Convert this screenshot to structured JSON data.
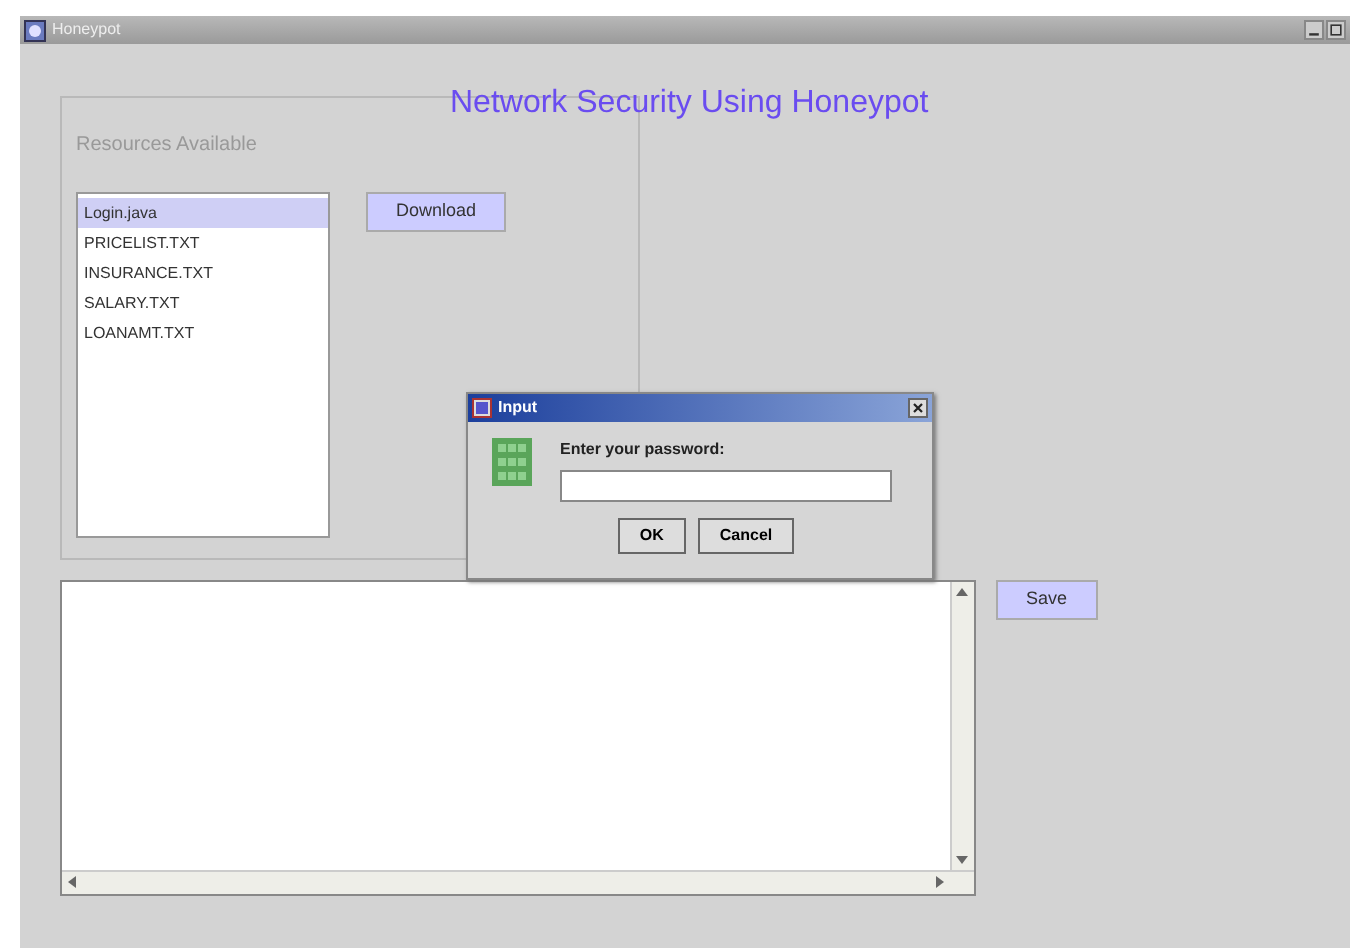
{
  "window": {
    "title": "Honeypot"
  },
  "heading": "Network Security Using Honeypot",
  "resources": {
    "label": "Resources Available",
    "download_button": "Download",
    "files": [
      {
        "name": "Login.java",
        "selected": true
      },
      {
        "name": "PRICELIST.TXT",
        "selected": false
      },
      {
        "name": "INSURANCE.TXT",
        "selected": false
      },
      {
        "name": "SALARY.TXT",
        "selected": false
      },
      {
        "name": "LOANAMT.TXT",
        "selected": false
      }
    ]
  },
  "log": {
    "save_button": "Save"
  },
  "dialog": {
    "title": "Input",
    "prompt": "Enter your password:",
    "buttons": [
      "OK",
      "Cancel"
    ]
  }
}
